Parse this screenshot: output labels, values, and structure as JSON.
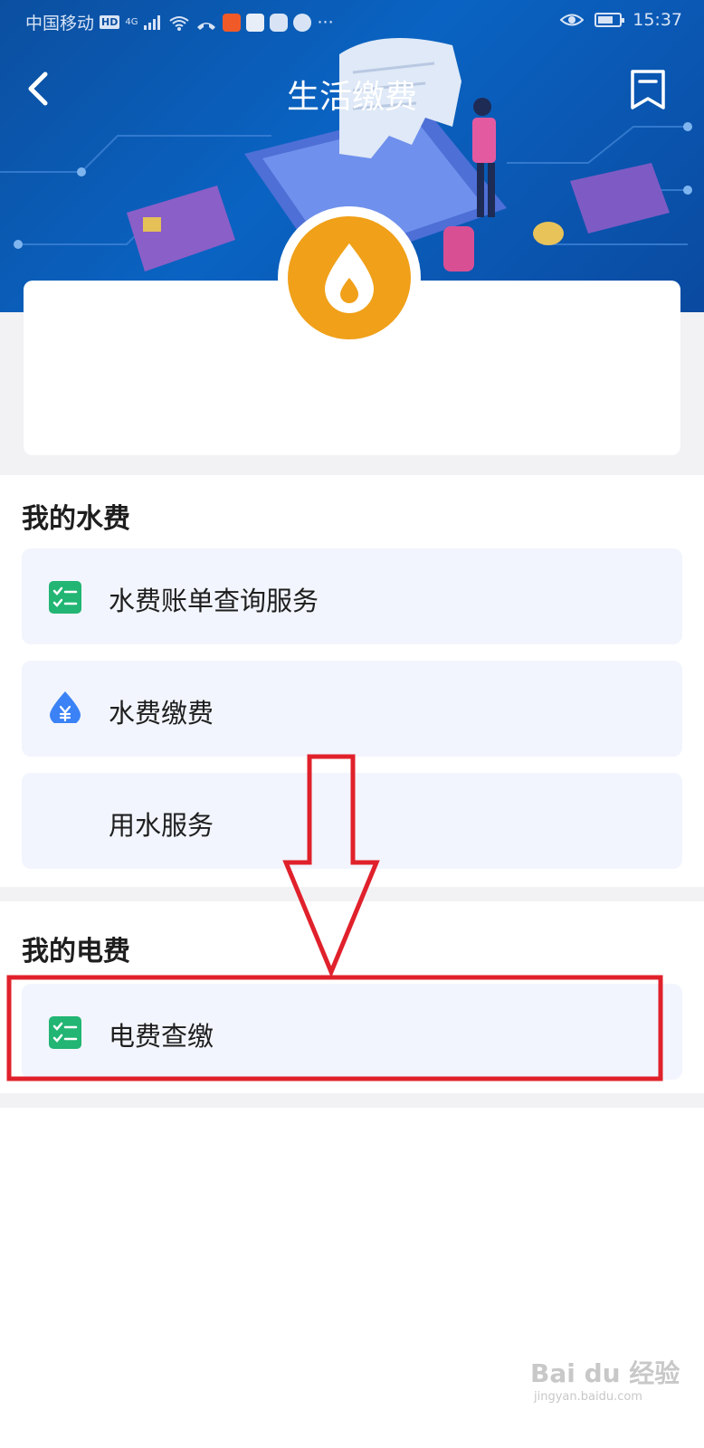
{
  "status_bar": {
    "carrier": "中国移动",
    "hd_badge": "HD",
    "network": "4G",
    "time": "15:37",
    "more": "···"
  },
  "header": {
    "title": "生活缴费",
    "back_icon": "chevron-left-icon",
    "bookmark_icon": "bookmark-icon"
  },
  "card": {
    "logo_icon": "water-drop-icon",
    "logo_color": "#f0a019"
  },
  "water_section": {
    "title": "我的水费",
    "items": [
      {
        "label": "水费账单查询服务",
        "icon": "checklist-icon",
        "icon_color": "#22b573"
      },
      {
        "label": "水费缴费",
        "icon": "yuan-drop-icon",
        "icon_color": "#3b82f6"
      },
      {
        "label": "用水服务",
        "icon": ""
      }
    ]
  },
  "electric_section": {
    "title": "我的电费",
    "items": [
      {
        "label": "电费查缴",
        "icon": "checklist-icon",
        "icon_color": "#22b573"
      }
    ]
  },
  "annotation": {
    "color": "#e0212b",
    "type": "arrow-down-with-highlight-box"
  },
  "watermark": {
    "text": "Bai du 经验",
    "sub": "jingyan.baidu.com"
  }
}
